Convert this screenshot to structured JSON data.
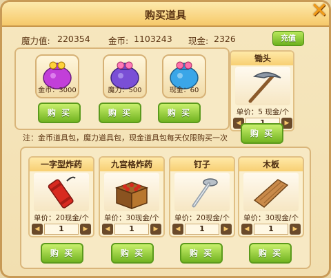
{
  "window": {
    "title": "购买道具",
    "close_glyph": "✕"
  },
  "stats": {
    "magic_label": "魔力值:",
    "magic_value": "220354",
    "gold_label": "金币:",
    "gold_value": "1103243",
    "cash_label": "现金:",
    "cash_value": "2326"
  },
  "recharge_label": "充值",
  "bags": [
    {
      "caption": "金币：3000",
      "color": "#c23fd9",
      "buy_label": "购 买"
    },
    {
      "caption": "魔力：500",
      "color": "#7a4fd6",
      "buy_label": "购 买"
    },
    {
      "caption": "现金：60",
      "color": "#3aa6e8",
      "buy_label": "购 买"
    }
  ],
  "hoe": {
    "name": "锄头",
    "price": "单价：5 现金/个",
    "quantity": "1",
    "buy_label": "购 买"
  },
  "note": "注：金币道具包，魔力道具包，现金道具包每天仅限购买一次",
  "items": [
    {
      "name": "一字型炸药",
      "price": "单价：20现金/个",
      "quantity": "1",
      "buy_label": "购 买",
      "icon": "dynamite-icon"
    },
    {
      "name": "九宫格炸药",
      "price": "单价：30现金/个",
      "quantity": "1",
      "buy_label": "购 买",
      "icon": "crate-bomb-icon"
    },
    {
      "name": "钉子",
      "price": "单价：20现金/个",
      "quantity": "1",
      "buy_label": "购 买",
      "icon": "nail-icon"
    },
    {
      "name": "木板",
      "price": "单价：30现金/个",
      "quantity": "1",
      "buy_label": "购 买",
      "icon": "plank-icon"
    }
  ],
  "colors": {
    "accent_green": "#71b320",
    "frame_brown": "#c89a56",
    "header_gold": "#f7cf73"
  },
  "stepper_icons": {
    "decrease": "◀",
    "increase": "▶"
  }
}
